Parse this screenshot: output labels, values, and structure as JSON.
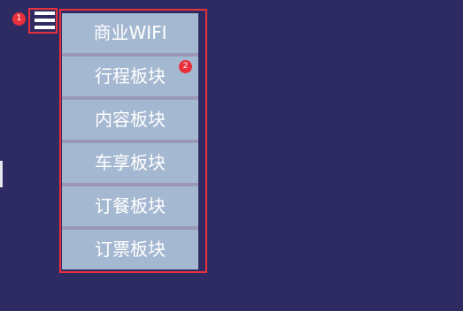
{
  "badges": {
    "menu_button": "1",
    "menu_item": "2"
  },
  "menu": {
    "items": [
      {
        "label": "商业WIFI"
      },
      {
        "label": "行程板块"
      },
      {
        "label": "内容板块"
      },
      {
        "label": "车享板块"
      },
      {
        "label": "订餐板块"
      },
      {
        "label": "订票板块"
      }
    ]
  },
  "colors": {
    "background": "#2e2b63",
    "menu_item": "#a5b8d1",
    "highlight": "#e8313b"
  },
  "icons": {
    "menu_button": "hamburger-menu-icon"
  }
}
